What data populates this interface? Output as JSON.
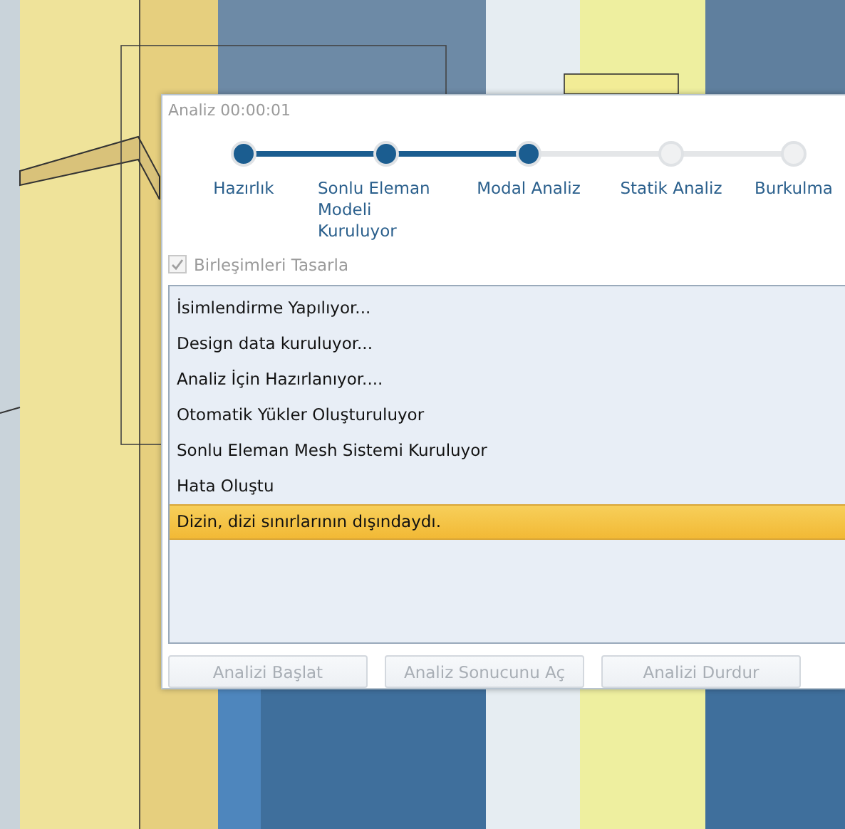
{
  "window": {
    "title": "Analiz 00:00:01"
  },
  "steps": [
    {
      "label": "Hazırlık",
      "done": true
    },
    {
      "label": "Sonlu Eleman Modeli Kuruluyor",
      "done": true
    },
    {
      "label": "Modal Analiz",
      "done": true
    },
    {
      "label": "Statik Analiz",
      "done": false
    },
    {
      "label": "Burkulma",
      "done": false
    }
  ],
  "design_connections": {
    "label": "Birleşimleri Tasarla",
    "checked": true,
    "disabled": true
  },
  "log": [
    {
      "text": "İsimlendirme Yapılıyor...",
      "selected": false
    },
    {
      "text": "Design data kuruluyor...",
      "selected": false
    },
    {
      "text": "Analiz İçin Hazırlanıyor....",
      "selected": false
    },
    {
      "text": "Otomatik Yükler Oluşturuluyor",
      "selected": false
    },
    {
      "text": "Sonlu Eleman Mesh Sistemi Kuruluyor",
      "selected": false
    },
    {
      "text": "Hata Oluştu",
      "selected": false
    },
    {
      "text": "Dizin, dizi sınırlarının dışındaydı.",
      "selected": true
    }
  ],
  "buttons": [
    {
      "label": "Analizi Başlat",
      "disabled": true
    },
    {
      "label": "Analiz Sonucunu Aç",
      "disabled": true
    },
    {
      "label": "Analizi Durdur",
      "disabled": true
    }
  ]
}
